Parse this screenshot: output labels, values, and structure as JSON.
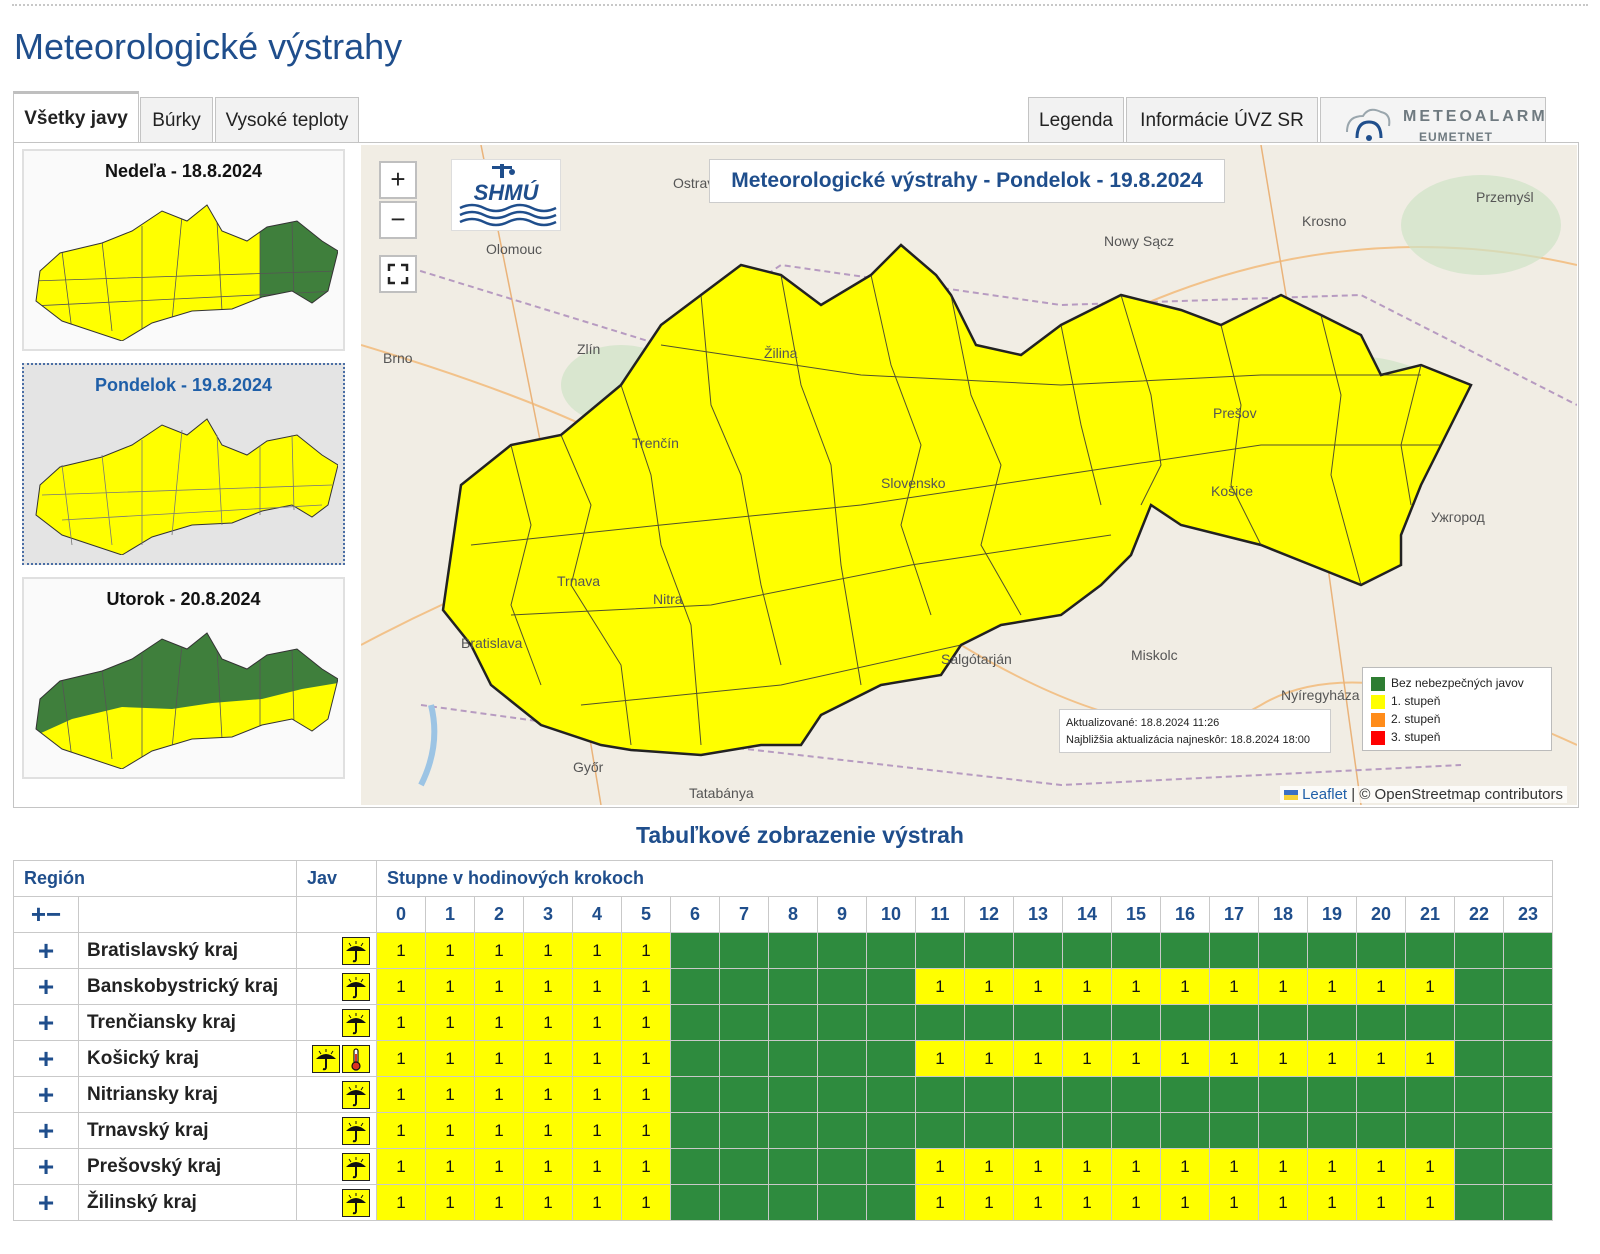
{
  "page": {
    "title": "Meteorologické výstrahy"
  },
  "tabs": {
    "left": [
      "Všetky javy",
      "Búrky",
      "Vysoké teploty"
    ],
    "right": [
      "Legenda",
      "Informácie ÚVZ SR"
    ],
    "meteoalarm": {
      "name": "METEOALARM",
      "sub": "EUMETNET"
    }
  },
  "days": [
    {
      "label": "Nedeľa - 18.8.2024",
      "fill_west": "#ffff00",
      "fill_east": "#3f7f3c"
    },
    {
      "label": "Pondelok - 19.8.2024",
      "fill_west": "#ffff00",
      "fill_east": "#ffff00"
    },
    {
      "label": "Utorok - 20.8.2024",
      "fill_north": "#3f7f3c",
      "fill_south": "#ffff00"
    }
  ],
  "map": {
    "title": "Meteorologické výstrahy - Pondelok - 19.8.2024",
    "logo": "SHMÚ",
    "zoom_in": "+",
    "zoom_out": "−",
    "fullscreen_icon": "fullscreen-icon",
    "cities": [
      "Ostrava",
      "Olomouc",
      "Brno",
      "Zlín",
      "Krosno",
      "Nowy Sącz",
      "Przemyśl",
      "Žilina",
      "Trenčín",
      "Prešov",
      "Slovensko",
      "Košice",
      "Ужгород",
      "Trnava",
      "Nitra",
      "Bratislava",
      "Salgótarján",
      "Miskolc",
      "Nyíregyháza",
      "Győr",
      "Tatabánya"
    ],
    "legend": [
      {
        "label": "Bez nebezpečných javov",
        "color": "#2e7d32"
      },
      {
        "label": "1. stupeň",
        "color": "#ffff00"
      },
      {
        "label": "2. stupeň",
        "color": "#ff8c1a"
      },
      {
        "label": "3. stupeň",
        "color": "#ff0000"
      }
    ],
    "updated": "Aktualizované: 18.8.2024 11:26",
    "next_update": "Najbližšia aktualizácia najneskôr: 18.8.2024 18:00",
    "attribution_leaflet": "Leaflet",
    "attribution_rest": " | © OpenStreetmap contributors"
  },
  "table": {
    "title": "Tabuľkové zobrazenie výstrah",
    "col_region": "Región",
    "col_phenomenon": "Jav",
    "col_steps": "Stupne v hodinových krokoch",
    "expand_all": "+",
    "collapse_all": "−",
    "hours": [
      "0",
      "1",
      "2",
      "3",
      "4",
      "5",
      "6",
      "7",
      "8",
      "9",
      "10",
      "11",
      "12",
      "13",
      "14",
      "15",
      "16",
      "17",
      "18",
      "19",
      "20",
      "21",
      "22",
      "23"
    ],
    "rows": [
      {
        "region": "Bratislavský kraj",
        "icons": [
          "umbrella"
        ],
        "levels": [
          1,
          1,
          1,
          1,
          1,
          1,
          0,
          0,
          0,
          0,
          0,
          0,
          0,
          0,
          0,
          0,
          0,
          0,
          0,
          0,
          0,
          0,
          0,
          0
        ]
      },
      {
        "region": "Banskobystrický kraj",
        "icons": [
          "umbrella"
        ],
        "levels": [
          1,
          1,
          1,
          1,
          1,
          1,
          0,
          0,
          0,
          0,
          0,
          1,
          1,
          1,
          1,
          1,
          1,
          1,
          1,
          1,
          1,
          1,
          0,
          0
        ]
      },
      {
        "region": "Trenčiansky kraj",
        "icons": [
          "umbrella"
        ],
        "levels": [
          1,
          1,
          1,
          1,
          1,
          1,
          0,
          0,
          0,
          0,
          0,
          0,
          0,
          0,
          0,
          0,
          0,
          0,
          0,
          0,
          0,
          0,
          0,
          0
        ]
      },
      {
        "region": "Košický kraj",
        "icons": [
          "umbrella",
          "thermometer"
        ],
        "levels": [
          1,
          1,
          1,
          1,
          1,
          1,
          0,
          0,
          0,
          0,
          0,
          1,
          1,
          1,
          1,
          1,
          1,
          1,
          1,
          1,
          1,
          1,
          0,
          0
        ]
      },
      {
        "region": "Nitriansky kraj",
        "icons": [
          "umbrella"
        ],
        "levels": [
          1,
          1,
          1,
          1,
          1,
          1,
          0,
          0,
          0,
          0,
          0,
          0,
          0,
          0,
          0,
          0,
          0,
          0,
          0,
          0,
          0,
          0,
          0,
          0
        ]
      },
      {
        "region": "Trnavský kraj",
        "icons": [
          "umbrella"
        ],
        "levels": [
          1,
          1,
          1,
          1,
          1,
          1,
          0,
          0,
          0,
          0,
          0,
          0,
          0,
          0,
          0,
          0,
          0,
          0,
          0,
          0,
          0,
          0,
          0,
          0
        ]
      },
      {
        "region": "Prešovský kraj",
        "icons": [
          "umbrella"
        ],
        "levels": [
          1,
          1,
          1,
          1,
          1,
          1,
          0,
          0,
          0,
          0,
          0,
          1,
          1,
          1,
          1,
          1,
          1,
          1,
          1,
          1,
          1,
          1,
          0,
          0
        ]
      },
      {
        "region": "Žilinský kraj",
        "icons": [
          "umbrella"
        ],
        "levels": [
          1,
          1,
          1,
          1,
          1,
          1,
          0,
          0,
          0,
          0,
          0,
          1,
          1,
          1,
          1,
          1,
          1,
          1,
          1,
          1,
          1,
          1,
          0,
          0
        ]
      }
    ],
    "level_colors": {
      "0": "#2e8b3e",
      "1": "#ffff00"
    },
    "row_expand": "+"
  }
}
